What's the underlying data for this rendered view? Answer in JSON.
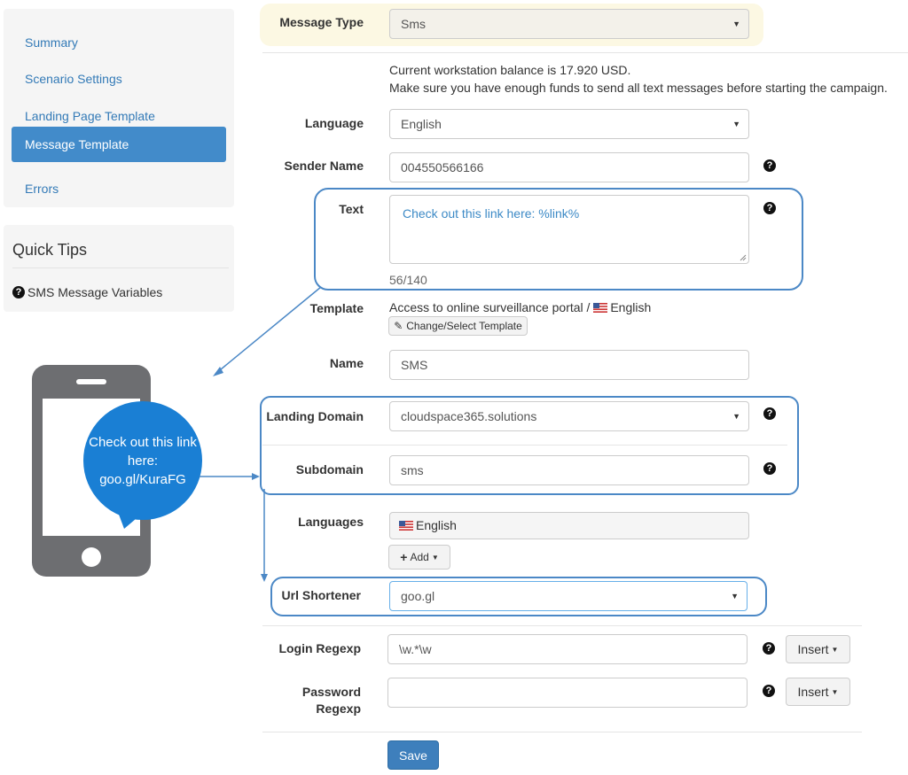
{
  "sidebar": {
    "items": [
      {
        "label": "Summary"
      },
      {
        "label": "Scenario Settings"
      },
      {
        "label": "Landing Page Template"
      },
      {
        "label": "Message Template"
      },
      {
        "label": "Errors"
      }
    ],
    "active_item": "Message Template"
  },
  "quick_tips": {
    "title": "Quick Tips",
    "link": "SMS Message Variables",
    "link_icon": "question-circle-icon"
  },
  "phone": {
    "bubble_text": "Check out this link here: goo.gl/KuraFG"
  },
  "form": {
    "message_type": {
      "label": "Message Type",
      "value": "Sms"
    },
    "balance": {
      "line1": "Current workstation balance is 17.920 USD.",
      "line2": "Make sure you have enough funds to send all text messages before starting the campaign."
    },
    "language": {
      "label": "Language",
      "value": "English"
    },
    "sender_name": {
      "label": "Sender Name",
      "value": "004550566166"
    },
    "text": {
      "label": "Text",
      "value": "Check out this link here: %link%",
      "counter": "56/140"
    },
    "template": {
      "label": "Template",
      "value": "Access to online surveillance portal /",
      "lang": "English",
      "button": "Change/Select Template"
    },
    "name": {
      "label": "Name",
      "value": "SMS"
    },
    "landing_domain": {
      "label": "Landing Domain",
      "value": "cloudspace365.solutions"
    },
    "subdomain": {
      "label": "Subdomain",
      "value": "sms"
    },
    "languages": {
      "label": "Languages",
      "value": "English",
      "add_button": "Add"
    },
    "url_shortener": {
      "label": "Url Shortener",
      "value": "goo.gl"
    },
    "login_regexp": {
      "label": "Login Regexp",
      "value": "\\w.*\\w",
      "insert_button": "Insert"
    },
    "password_regexp": {
      "label1": "Password",
      "label2": "Regexp",
      "value": "",
      "insert_button": "Insert"
    },
    "save_button": "Save"
  },
  "colors": {
    "accent": "#428bca",
    "highlight_row": "#fcf8e3",
    "annotation": "#4b88c6",
    "phone_body": "#6d6e71",
    "bubble": "#1a7fd4"
  }
}
